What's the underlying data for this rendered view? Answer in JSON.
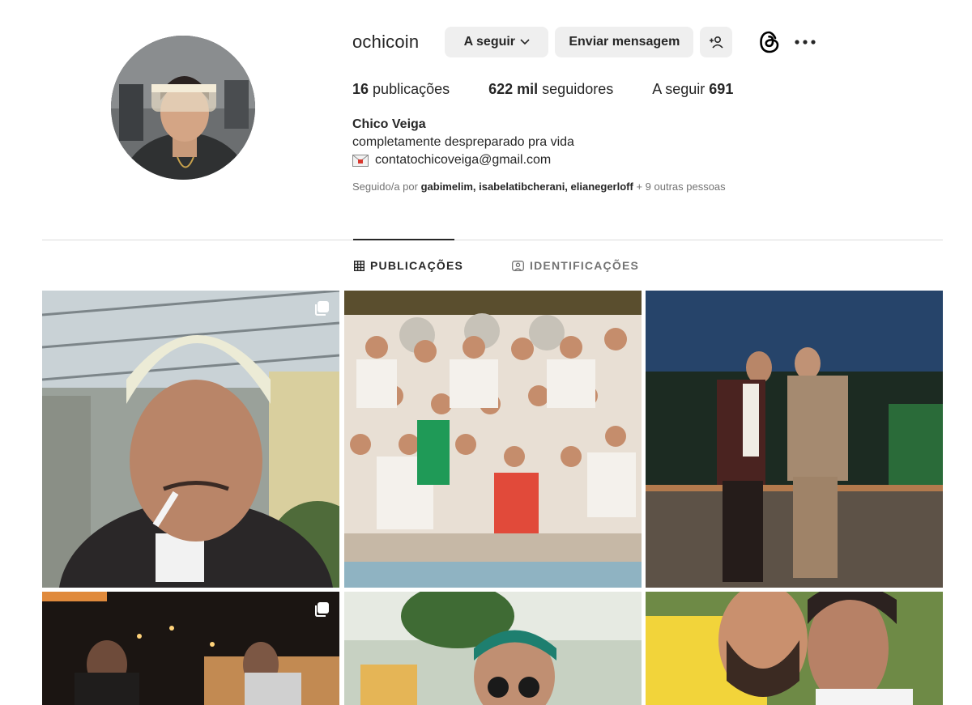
{
  "profile": {
    "username": "ochicoin",
    "follow_label": "A seguir",
    "message_label": "Enviar mensagem",
    "add_user_icon": "add-user-icon",
    "threads_icon": "threads-icon",
    "more_icon": "more-icon",
    "stats": {
      "posts_count": "16",
      "posts_label": "publicações",
      "followers_count": "622 mil",
      "followers_label": "seguidores",
      "following_label": "A seguir",
      "following_count": "691"
    },
    "full_name": "Chico Veiga",
    "bio": "completamente despreparado pra vida",
    "email": "contatochicoveiga@gmail.com",
    "followed_by": {
      "prefix": "Seguido/a por",
      "names": "gabimelim, isabelatibcherani, elianegerloff",
      "suffix": "+ 9 outras pessoas"
    }
  },
  "tabs": {
    "posts": "PUBLICAÇÕES",
    "tagged": "IDENTIFICAÇÕES"
  },
  "colors": {
    "accent_text": "#262626",
    "muted_text": "#737373",
    "button_bg": "#efefef",
    "divider": "#dbdbdb"
  }
}
